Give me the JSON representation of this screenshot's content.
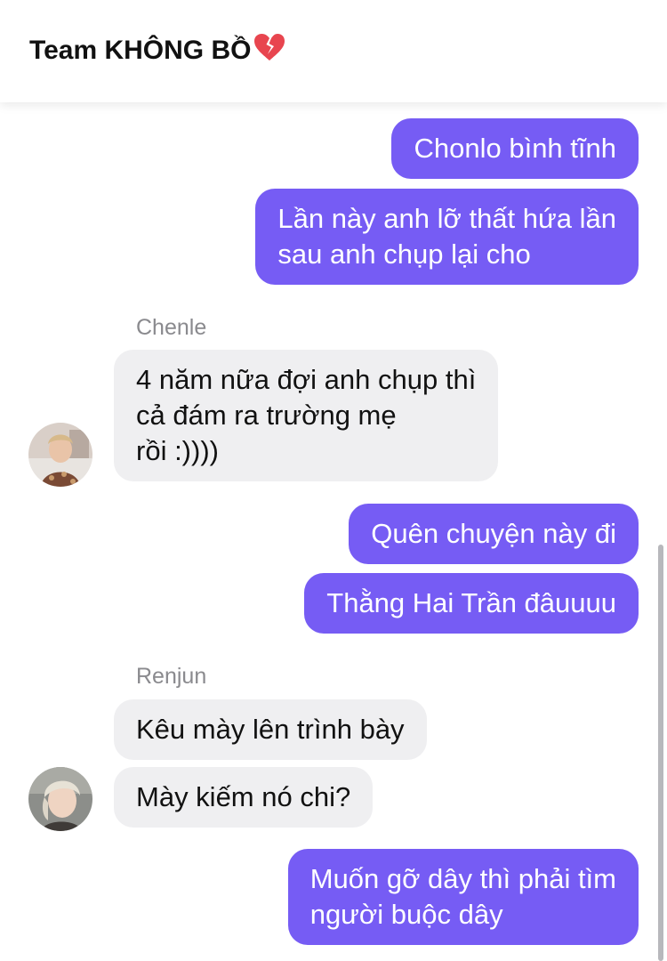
{
  "header": {
    "title": "Team KHÔNG BỒ",
    "emoji_icon": "broken-heart-icon"
  },
  "messages": [
    {
      "side": "out",
      "text": "Chonlo bình tĩnh"
    },
    {
      "side": "out",
      "lines": [
        "Lần này anh lỡ thất hứa lần",
        "sau anh chụp lại cho"
      ]
    },
    {
      "side": "in",
      "sender": "Chenle",
      "lines": [
        "4 năm nữa đợi anh chụp thì",
        "cả đám ra trường mẹ",
        "rồi :))))"
      ]
    },
    {
      "side": "out",
      "text": "Quên chuyện này đi"
    },
    {
      "side": "out",
      "text": "Thằng Hai Trần đâuuuu"
    },
    {
      "side": "in",
      "sender": "Renjun",
      "text": "Kêu mày lên trình bày"
    },
    {
      "side": "in",
      "text": "Mày kiếm nó chi?"
    },
    {
      "side": "out",
      "lines": [
        "Muốn gỡ dây thì phải tìm",
        "người buộc dây"
      ]
    }
  ],
  "colors": {
    "outgoing_bubble": "#765cf4",
    "incoming_bubble": "#efeff1",
    "sender_name": "#8a8a8e"
  }
}
